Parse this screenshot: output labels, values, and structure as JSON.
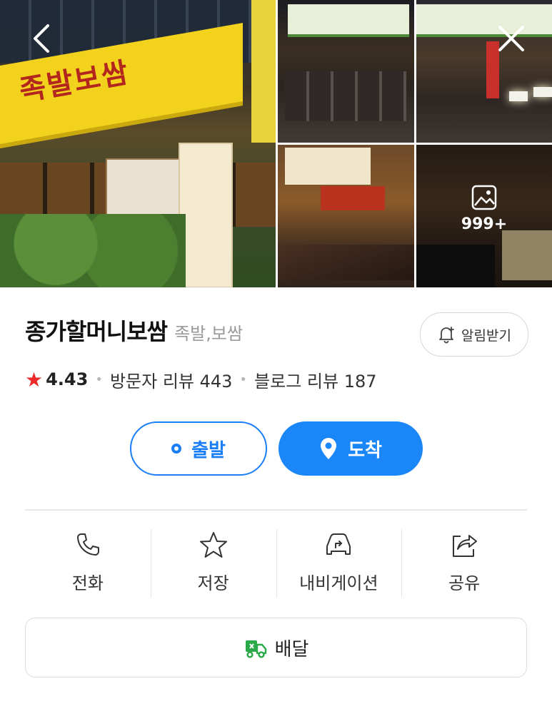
{
  "gallery": {
    "main_sign_text": "족발보쌈",
    "more_count": "999+"
  },
  "place": {
    "name": "종가할머니보쌈",
    "category": "족발,보쌈"
  },
  "alert_button": {
    "label": "알림받기"
  },
  "rating": {
    "score": "4.43",
    "visitor_reviews": "방문자 리뷰 443",
    "blog_reviews": "블로그 리뷰 187"
  },
  "route": {
    "depart_label": "출발",
    "arrive_label": "도착"
  },
  "actions": [
    {
      "label": "전화",
      "icon": "phone-icon"
    },
    {
      "label": "저장",
      "icon": "star-icon"
    },
    {
      "label": "내비게이션",
      "icon": "navigation-icon"
    },
    {
      "label": "공유",
      "icon": "share-icon"
    }
  ],
  "delivery": {
    "label": "배달"
  },
  "colors": {
    "primary_blue": "#1a86f7",
    "star_red": "#ec2a2a",
    "delivery_green": "#2aa84a"
  }
}
